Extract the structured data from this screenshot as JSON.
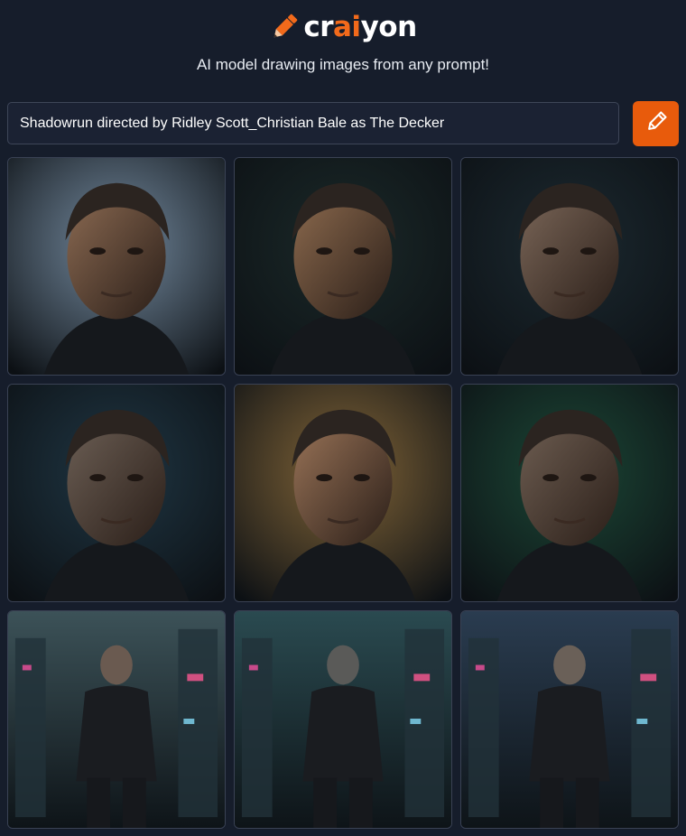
{
  "brand": {
    "name_prefix": "cr",
    "name_accent": "ai",
    "name_suffix": "yon",
    "tagline": "AI model drawing images from any prompt!",
    "accent_color": "#f26a1b",
    "logo_icon": "pencil-icon"
  },
  "prompt": {
    "value": "Shadowrun directed by Ridley Scott_Christian Bale as The Decker"
  },
  "draw_button": {
    "icon": "pencil-icon",
    "color": "#e85b0c"
  },
  "results": {
    "images": [
      {
        "theme": "closeup",
        "bg": "#7c93a8",
        "skin": "#8b6a52"
      },
      {
        "theme": "closeup",
        "bg": "#1b2a28",
        "skin": "#8c6a4e"
      },
      {
        "theme": "closeup",
        "bg": "#1c2a30",
        "skin": "#7a6658"
      },
      {
        "theme": "closeup",
        "bg": "#203845",
        "skin": "#6c5f55"
      },
      {
        "theme": "closeup",
        "bg": "#8a6a38",
        "skin": "#9a7458"
      },
      {
        "theme": "closeup",
        "bg": "#1c4a36",
        "skin": "#6e5e52"
      },
      {
        "theme": "city",
        "bg": "#3c5258",
        "skin": "#6a5a50"
      },
      {
        "theme": "city",
        "bg": "#2a4a50",
        "skin": "#5a5a58"
      },
      {
        "theme": "city",
        "bg": "#2a3c50",
        "skin": "#6a6058"
      }
    ]
  }
}
